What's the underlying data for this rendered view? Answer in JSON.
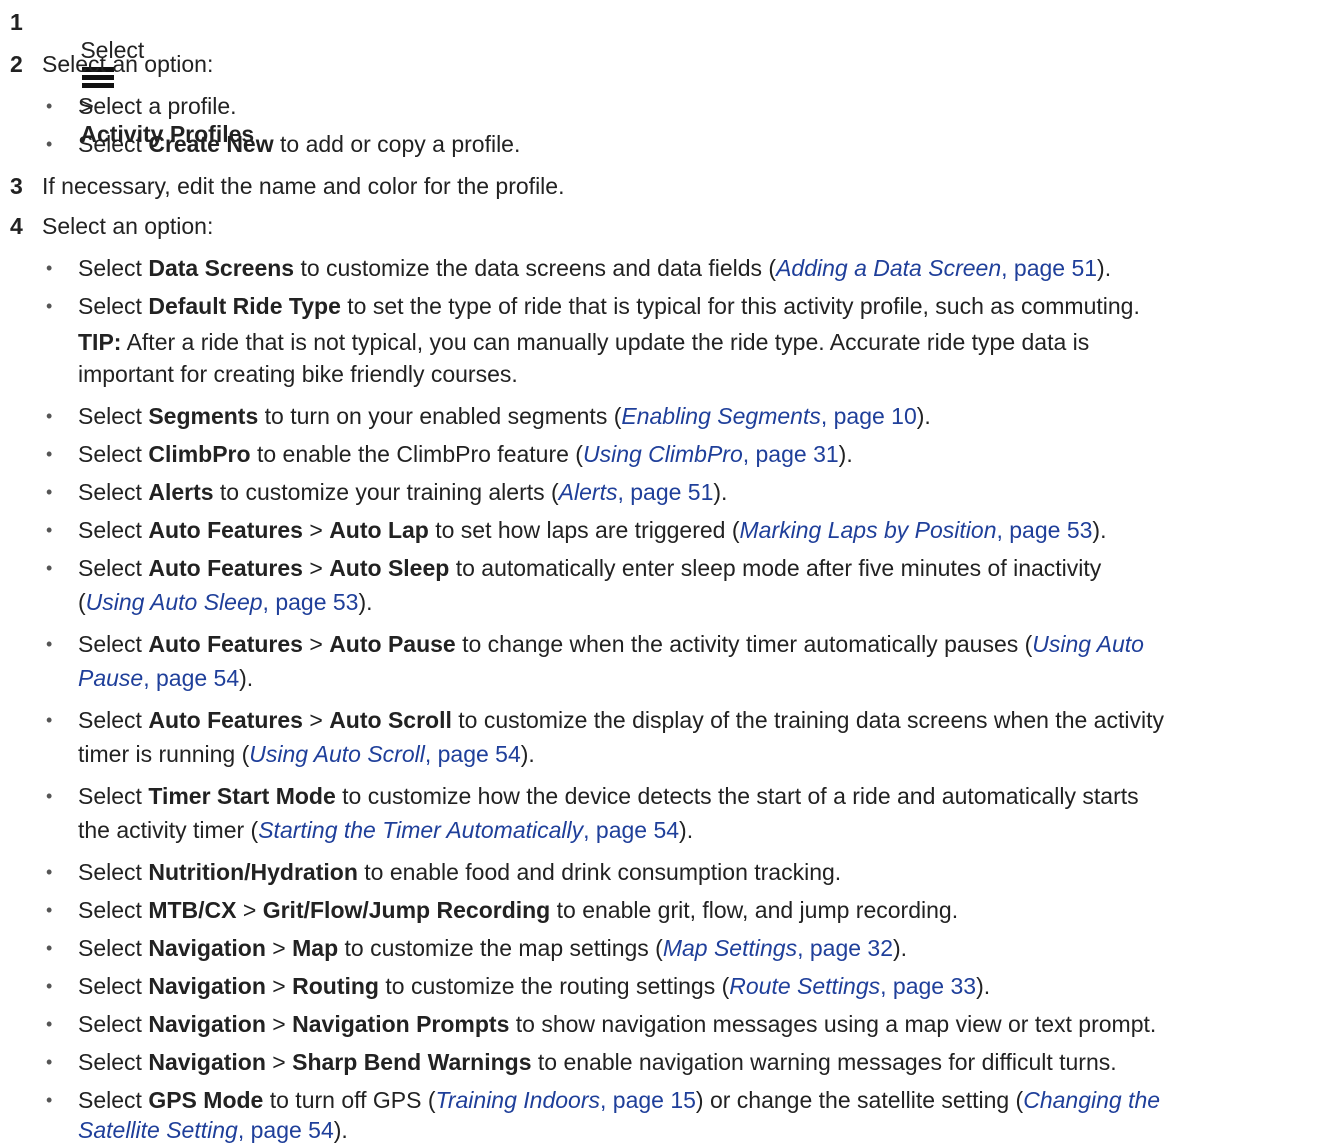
{
  "bullet": "•",
  "steps": [
    {
      "number": "1",
      "pre": "Select",
      "icon": "menu-icon",
      "sep": ">",
      "bold": "Activity Profiles",
      "post": "."
    },
    {
      "number": "2",
      "text": "Select an option:",
      "items": [
        {
          "text": "Select a profile."
        },
        {
          "pre": "Select ",
          "bold": "Create New",
          "post": " to add or copy a profile."
        }
      ]
    },
    {
      "number": "3",
      "text": "If necessary, edit the name and color for the profile."
    },
    {
      "number": "4",
      "text": "Select an option:"
    }
  ],
  "o": {
    "i0": {
      "a": "Select ",
      "b": "Data Screens",
      "c": " to customize the data screens and data fields (",
      "li": "Adding a Data Screen",
      "lp": ", page 51",
      "d": ")."
    },
    "i1": {
      "a": "Select ",
      "b": "Default Ride Type",
      "c": " to set the type of ride that is typical for this activity profile, such as commuting."
    },
    "tip": {
      "label": "TIP:",
      "line1": " After a ride that is not typical, you can manually update the ride type. Accurate ride type data is",
      "line2": "important for creating bike friendly courses."
    },
    "i2": {
      "a": "Select ",
      "b": "Segments",
      "c": " to turn on your enabled segments (",
      "li": "Enabling Segments",
      "lp": ", page 10",
      "d": ")."
    },
    "i3": {
      "a": "Select ",
      "b": "ClimbPro",
      "c": " to enable the ClimbPro feature (",
      "li": "Using ClimbPro",
      "lp": ", page 31",
      "d": ")."
    },
    "i4": {
      "a": "Select ",
      "b": "Alerts",
      "c": " to customize your training alerts (",
      "li": "Alerts",
      "lp": ", page 51",
      "d": ")."
    },
    "i5": {
      "a": "Select ",
      "b": "Auto Features",
      "s": " > ",
      "b2": "Auto Lap",
      "c": " to set how laps are triggered (",
      "li": "Marking Laps by Position",
      "lp": ", page 53",
      "d": ")."
    },
    "i6": {
      "a": "Select ",
      "b": "Auto Features",
      "s": " > ",
      "b2": "Auto Sleep",
      "c": " to automatically enter sleep mode after five minutes of inactivity",
      "e": "(",
      "li": "Using Auto Sleep",
      "lp": ", page 53",
      "d": ")."
    },
    "i7": {
      "a": "Select ",
      "b": "Auto Features",
      "s": " > ",
      "b2": "Auto Pause",
      "c": " to change when the activity timer automatically pauses (",
      "li1": "Using Auto",
      "li2": "Pause",
      "lp": ", page 54",
      "d": ")."
    },
    "i8": {
      "a": "Select ",
      "b": "Auto Features",
      "s": " > ",
      "b2": "Auto Scroll",
      "c": " to customize the display of the training data screens when the activity",
      "e": "timer is running (",
      "li": "Using Auto Scroll",
      "lp": ", page 54",
      "d": ")."
    },
    "i9": {
      "a": "Select ",
      "b": "Timer Start Mode",
      "c": " to customize how the device detects the start of a ride and automatically starts",
      "e": "the activity timer (",
      "li": "Starting the Timer Automatically",
      "lp": ", page 54",
      "d": ")."
    },
    "i10": {
      "a": "Select ",
      "b": "Nutrition/Hydration",
      "c": " to enable food and drink consumption tracking."
    },
    "i11": {
      "a": "Select ",
      "b": "MTB/CX",
      "s": " > ",
      "b2": "Grit/Flow/Jump Recording",
      "c": " to enable grit, flow, and jump recording."
    },
    "i12": {
      "a": "Select ",
      "b": "Navigation",
      "s": " > ",
      "b2": "Map",
      "c": " to customize the map settings (",
      "li": "Map Settings",
      "lp": ", page 32",
      "d": ")."
    },
    "i13": {
      "a": "Select ",
      "b": "Navigation",
      "s": " > ",
      "b2": "Routing",
      "c": " to customize the routing settings (",
      "li": "Route Settings",
      "lp": ", page 33",
      "d": ")."
    },
    "i14": {
      "a": "Select ",
      "b": "Navigation",
      "s": " > ",
      "b2": "Navigation Prompts",
      "c": " to show navigation messages using a map view or text prompt."
    },
    "i15": {
      "a": "Select ",
      "b": "Navigation",
      "s": " > ",
      "b2": "Sharp Bend Warnings",
      "c": " to enable navigation warning messages for difficult turns."
    },
    "i16": {
      "a": "Select ",
      "b": "GPS Mode",
      "c": " to turn off GPS (",
      "li": "Training Indoors",
      "lp": ", page 15",
      "d": ") or change the satellite setting (",
      "li2a": "Changing the",
      "li2b": "Satellite Setting",
      "lp2": ", page 54",
      "e": ")."
    }
  }
}
